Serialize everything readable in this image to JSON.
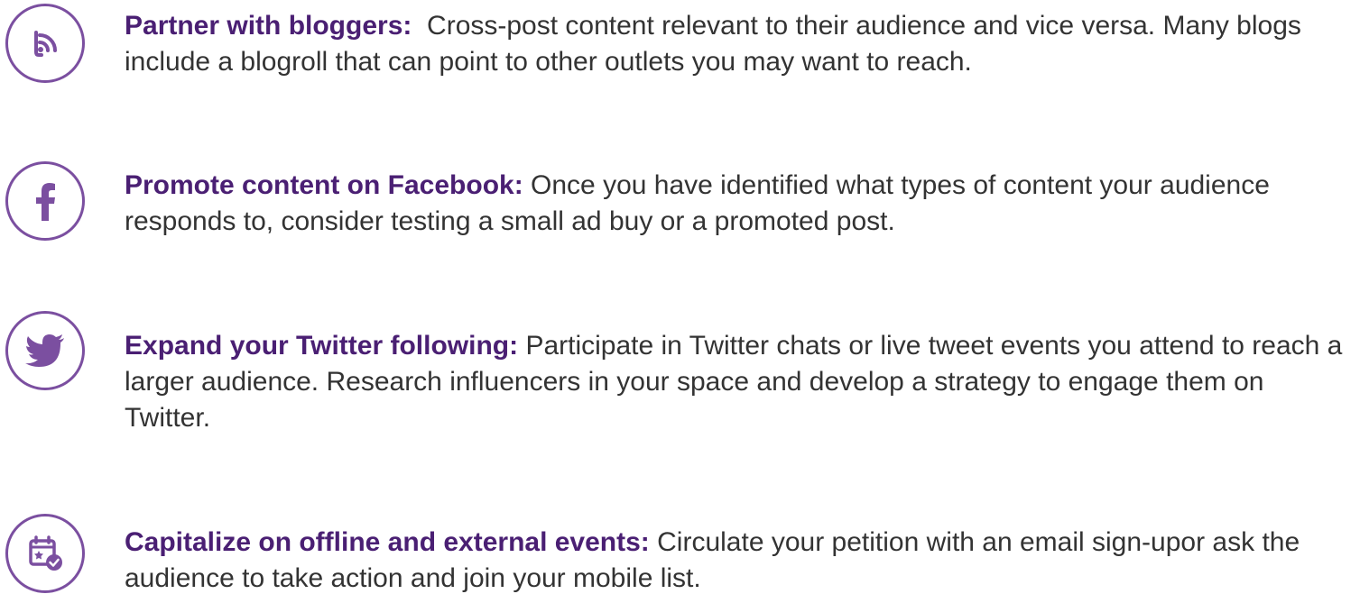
{
  "accent_color": "#7b4fa0",
  "heading_color": "#4a1f73",
  "tips": [
    {
      "icon": "rss-icon",
      "heading": "Partner with bloggers:",
      "body": "  Cross-post content relevant to their audience and vice versa. Many blogs include a blogroll that can point to other outlets you may want to reach."
    },
    {
      "icon": "facebook-icon",
      "heading": "Promote content on Facebook:",
      "body": " Once you have identified what types of content your audience responds to, consider testing a small ad buy or a promoted post."
    },
    {
      "icon": "twitter-icon",
      "heading": "Expand your Twitter following:",
      "body": " Participate in Twitter chats or live tweet events you attend to reach a larger audience. Research influencers in your space and develop a strategy to engage them on Twitter."
    },
    {
      "icon": "calendar-event-icon",
      "heading": "Capitalize on offline and external events:",
      "body": " Circulate your petition with an email sign-upor ask the audience to take action and join your mobile list."
    }
  ]
}
